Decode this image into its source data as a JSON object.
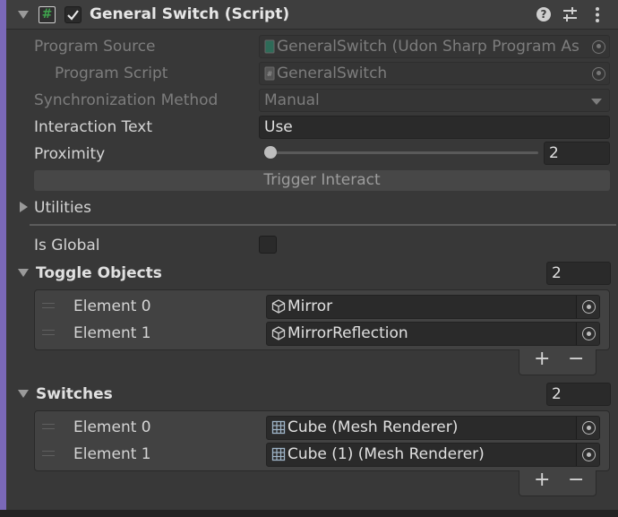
{
  "header": {
    "title": "General Switch (Script)",
    "script_icon_glyph": "#",
    "enabled": true
  },
  "fields": {
    "program_source": {
      "label": "Program Source",
      "value": "GeneralSwitch (Udon Sharp Program As"
    },
    "program_script": {
      "label": "Program Script",
      "value": "GeneralSwitch"
    },
    "sync_method": {
      "label": "Synchronization Method",
      "value": "Manual"
    },
    "interaction_text": {
      "label": "Interaction Text",
      "value": "Use"
    },
    "proximity": {
      "label": "Proximity",
      "value": "2",
      "slider_fraction": 0.0
    },
    "trigger_button": "Trigger Interact",
    "utilities": "Utilities",
    "is_global": {
      "label": "Is Global",
      "checked": false
    }
  },
  "toggle_objects": {
    "label": "Toggle Objects",
    "count": "2",
    "elements": [
      {
        "label": "Element 0",
        "value": "Mirror",
        "icon": "gameobject-icon"
      },
      {
        "label": "Element 1",
        "value": "MirrorReflection",
        "icon": "gameobject-icon"
      }
    ]
  },
  "switches": {
    "label": "Switches",
    "count": "2",
    "elements": [
      {
        "label": "Element 0",
        "value": "Cube (Mesh Renderer)",
        "icon": "mesh-renderer-icon"
      },
      {
        "label": "Element 1",
        "value": "Cube (1) (Mesh Renderer)",
        "icon": "mesh-renderer-icon"
      }
    ]
  },
  "list_buttons": {
    "add": "+",
    "remove": "−"
  },
  "icons": [
    "help-icon",
    "presets-icon",
    "more-icon",
    "foldout-icon",
    "script-icon",
    "checkbox-icon",
    "target-icon",
    "dropdown-arrow-icon"
  ],
  "colors": {
    "accent_bar": "#7a68b8",
    "background": "#383838",
    "field": "#2a2a2a",
    "script_icon": "#3fa34d"
  }
}
